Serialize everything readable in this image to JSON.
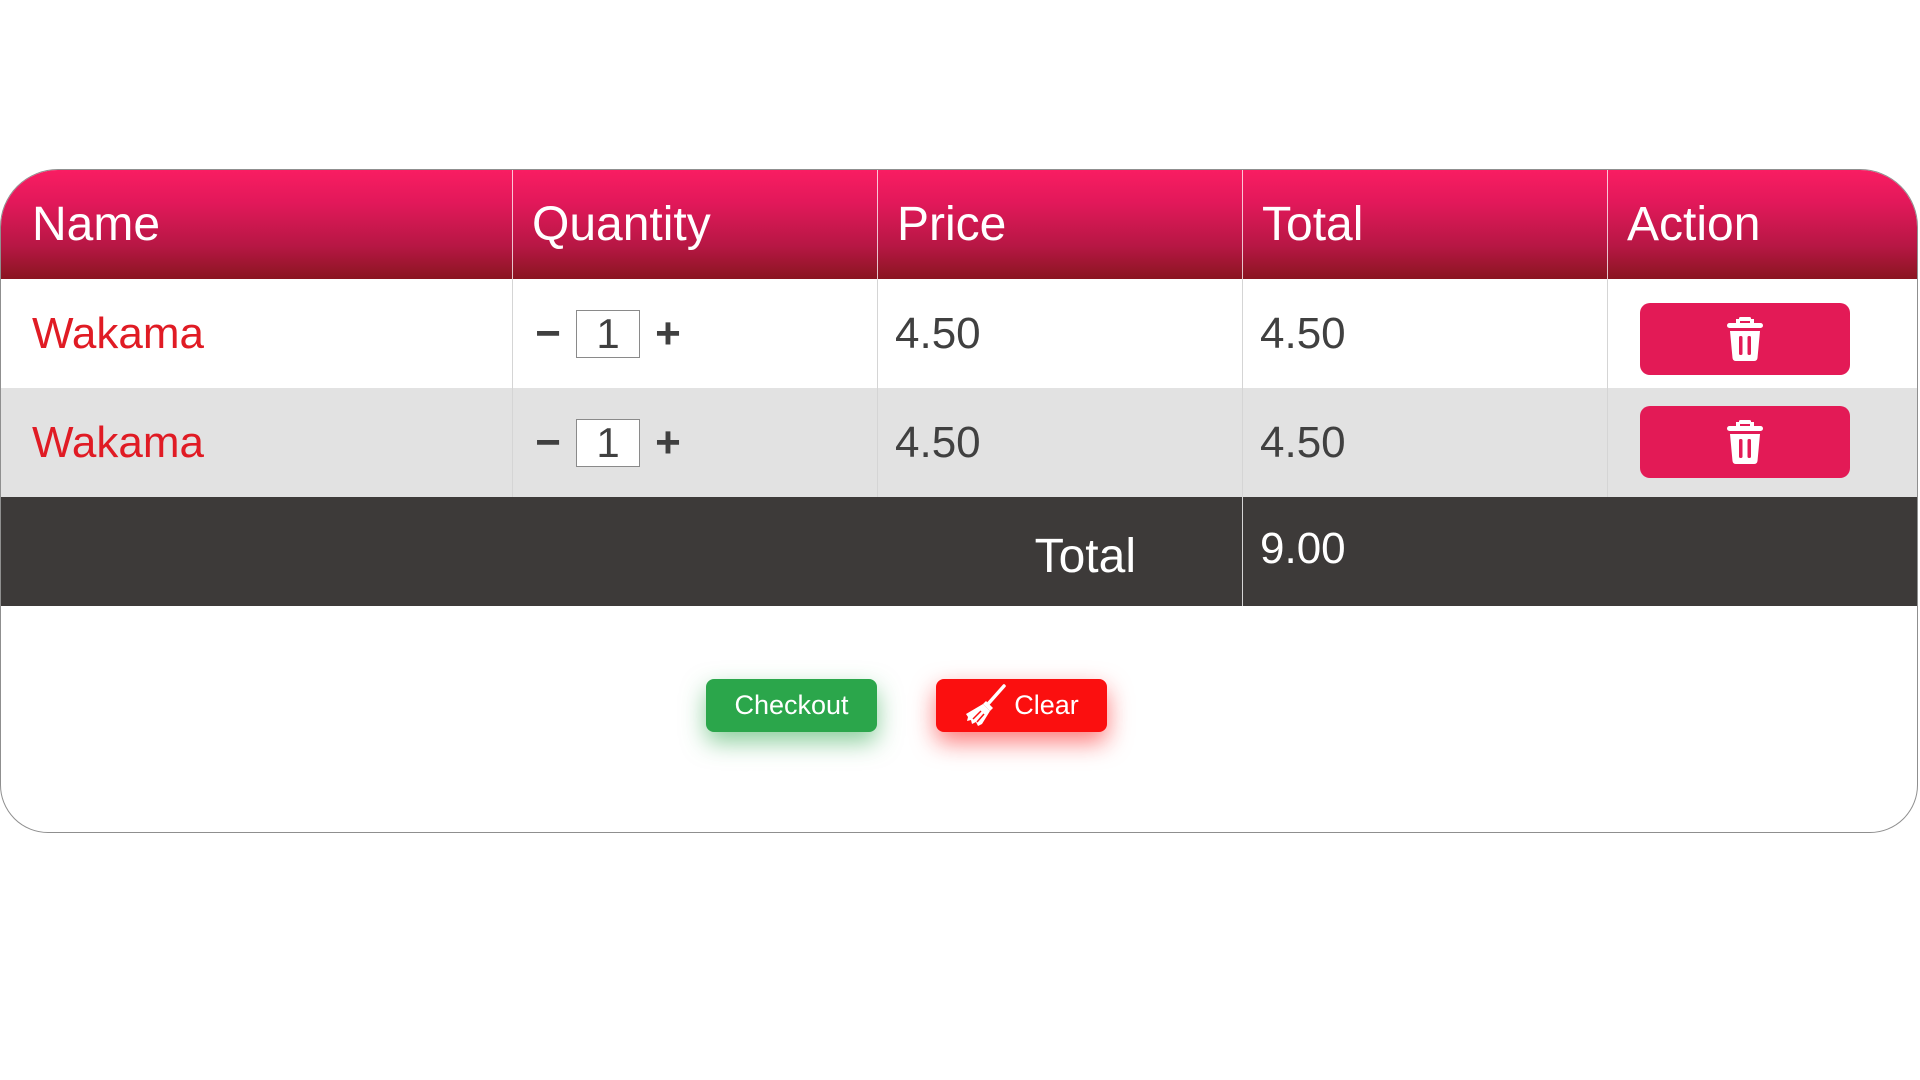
{
  "table": {
    "headers": [
      "Name",
      "Quantity",
      "Price",
      "Total",
      "Action"
    ],
    "rows": [
      {
        "name": "Wakama",
        "quantity": "1",
        "price": "4.50",
        "total": "4.50"
      },
      {
        "name": "Wakama",
        "quantity": "1",
        "price": "4.50",
        "total": "4.50"
      }
    ],
    "quantity_controls": {
      "decrement": "−",
      "increment": "+"
    },
    "action_icon": "trash-icon",
    "footer": {
      "label": "Total",
      "value": "9.00"
    }
  },
  "buttons": {
    "checkout_label": "Checkout",
    "clear_label": "Clear",
    "clear_icon": "broom-icon"
  },
  "colors": {
    "header_top": "#f91d62",
    "header_bottom": "#8a1520",
    "item_name": "#e01b24",
    "delete_button": "#e31a56",
    "total_row": "#3d3a39",
    "checkout": "#2ba64b",
    "clear": "#fb0f0f",
    "alt_row": "#e2e2e2"
  }
}
